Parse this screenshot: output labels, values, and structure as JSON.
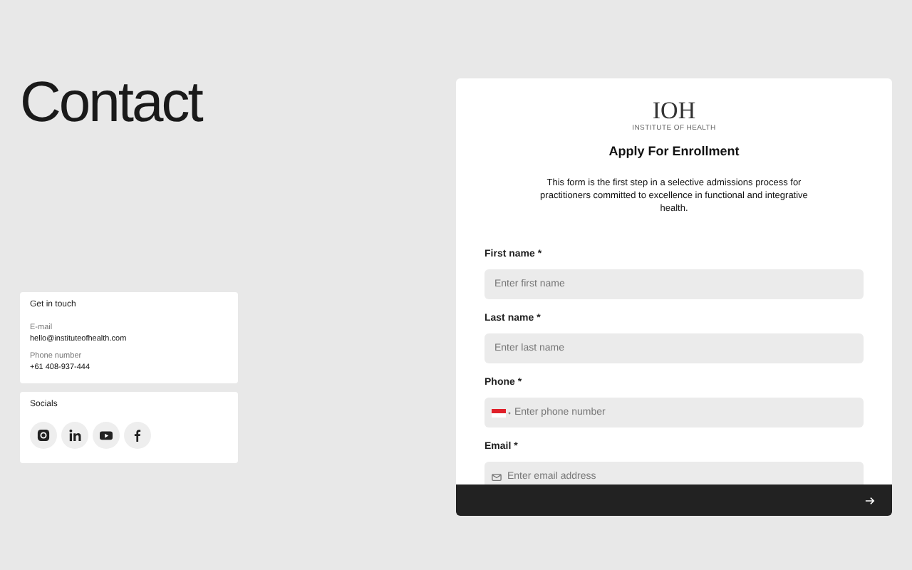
{
  "heading": "Contact",
  "contact_card": {
    "title": "Get in touch",
    "items": [
      {
        "label": "E-mail",
        "value": "hello@instituteofhealth.com"
      },
      {
        "label": "Phone number",
        "value": "+61 408-937-444"
      }
    ]
  },
  "socials_card": {
    "title": "Socials",
    "links": [
      {
        "kind": "instagram"
      },
      {
        "kind": "linkedin"
      },
      {
        "kind": "youtube"
      },
      {
        "kind": "facebook"
      }
    ]
  },
  "form": {
    "logo": {
      "mark": "IOH",
      "tagline": "INSTITUTE OF HEALTH"
    },
    "title": "Apply For Enrollment",
    "intro": "This form is the first step in a selective admissions process for practitioners committed to excellence in functional and integrative health.",
    "fields": [
      {
        "kind": "text",
        "label": "First name *",
        "placeholder": "Enter first name"
      },
      {
        "kind": "text",
        "label": "Last name *",
        "placeholder": "Enter last name"
      },
      {
        "kind": "phone",
        "label": "Phone *",
        "placeholder": "Enter phone number"
      },
      {
        "kind": "email",
        "label": "Email *",
        "placeholder": "Enter email address"
      }
    ]
  }
}
